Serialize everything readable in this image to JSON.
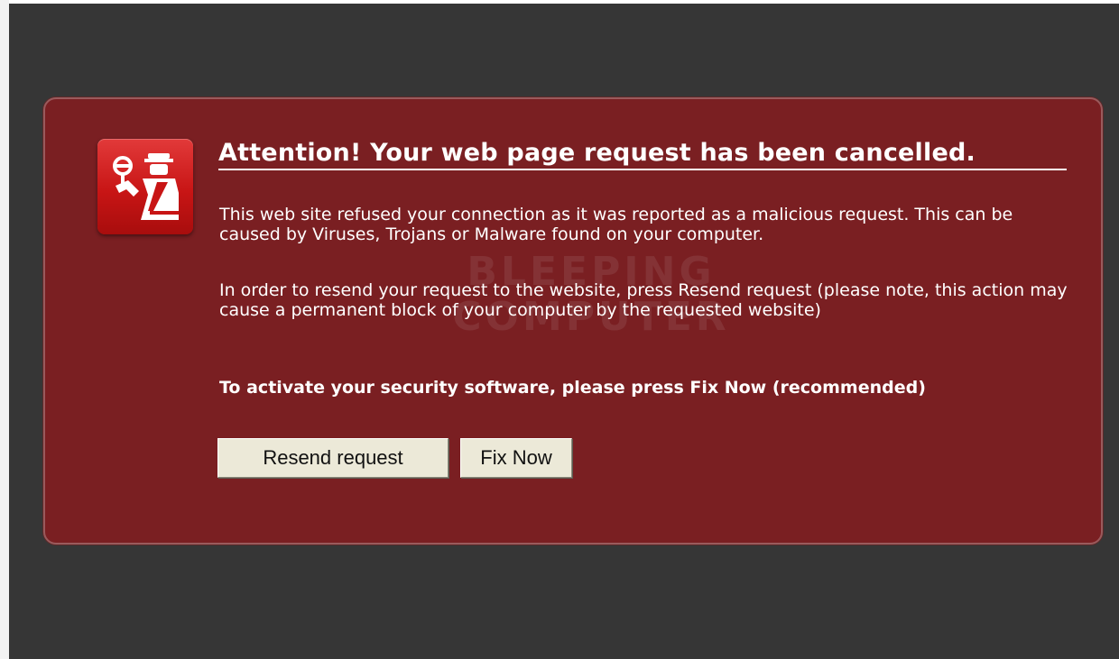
{
  "page": {
    "background_color": "#363636",
    "panel_color": "#7a1f22"
  },
  "alert": {
    "icon": "security-guard-icon",
    "title": "Attention! Your web page request has been cancelled.",
    "paragraph1": "This web site refused your connection as it was reported as a malicious request. This can be caused by Viruses, Trojans or Malware found on your computer.",
    "paragraph2": "In order to resend your request to the website, press Resend request (please note, this action may cause a permanent block of your computer by the requested website)",
    "paragraph3": "To activate your security software, please press Fix Now (recommended)",
    "watermark_line1": "BLEEPING",
    "watermark_line2": "COMPUTER"
  },
  "buttons": {
    "resend_label": "Resend request",
    "fix_label": "Fix Now"
  }
}
